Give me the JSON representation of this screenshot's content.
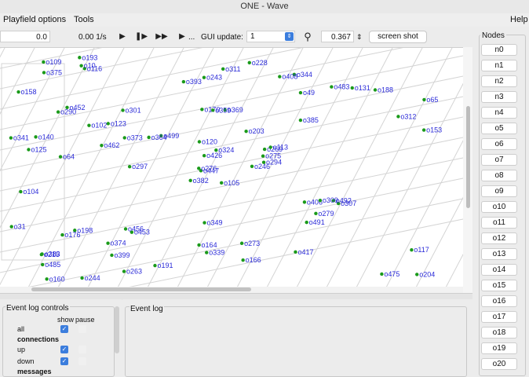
{
  "window": {
    "title": "ONE - Wave"
  },
  "menubar": {
    "playfield_options": "Playfield options",
    "tools": "Tools",
    "help": "Help"
  },
  "toolbar": {
    "sim_time": "0.0",
    "speed": "0.00 1/s",
    "play_icon": "play-icon",
    "step_icon": "step-icon",
    "fast_forward_icon": "fast-forward-icon",
    "play_until_label": "...",
    "gui_update_label": "GUI update:",
    "gui_update_value": "1",
    "zoom_icon": "magnifier-icon",
    "zoom_value": "0.367",
    "screenshot_label": "screen shot"
  },
  "nodes_panel": {
    "title": "Nodes",
    "nodes": [
      "n0",
      "n1",
      "n2",
      "n3",
      "n4",
      "o5",
      "o6",
      "o7",
      "o8",
      "o9",
      "o10",
      "o11",
      "o12",
      "o13",
      "o14",
      "o15",
      "o16",
      "o17",
      "o18",
      "o19",
      "o20"
    ]
  },
  "event_log_controls": {
    "title": "Event log controls",
    "show_header": "show",
    "pause_header": "pause",
    "rows": [
      {
        "label": "all",
        "show": true,
        "pause": false
      },
      {
        "label": "connections",
        "header": true
      },
      {
        "label": "up",
        "show": true,
        "pause": false
      },
      {
        "label": "down",
        "show": true,
        "pause": false
      },
      {
        "label": "messages",
        "header": true
      }
    ]
  },
  "event_log": {
    "title": "Event log"
  },
  "playfield": {
    "node_color": "#2a2ad8",
    "dot_color": "#1a9a1a",
    "labels": [
      "o105",
      "o290",
      "o447",
      "o383",
      "o269",
      "o453",
      "o344",
      "o369",
      "o49",
      "o246",
      "o116",
      "o204",
      "o64",
      "o65",
      "o382",
      "o385",
      "o244",
      "o170",
      "o203",
      "o198",
      "o499",
      "o485",
      "o399",
      "o359",
      "o113",
      "o307",
      "o452",
      "o243",
      "o125",
      "o406",
      "o153",
      "o276",
      "o164",
      "o426",
      "o301",
      "o483",
      "o456",
      "o475",
      "o117",
      "o492",
      "o228",
      "o364",
      "o462",
      "o491",
      "o263",
      "o341",
      "o275",
      "o160",
      "o339",
      "o294",
      "o176",
      "o312",
      "o158",
      "o279",
      "o417",
      "o374",
      "o10",
      "o109",
      "o273",
      "o188",
      "o311",
      "o297",
      "o140",
      "o123",
      "o131",
      "o193",
      "o408",
      "o393",
      "o324",
      "o31",
      "o349",
      "o191",
      "o309",
      "o373",
      "o215",
      "o375",
      "o102",
      "o104",
      "o120",
      "o166"
    ]
  }
}
